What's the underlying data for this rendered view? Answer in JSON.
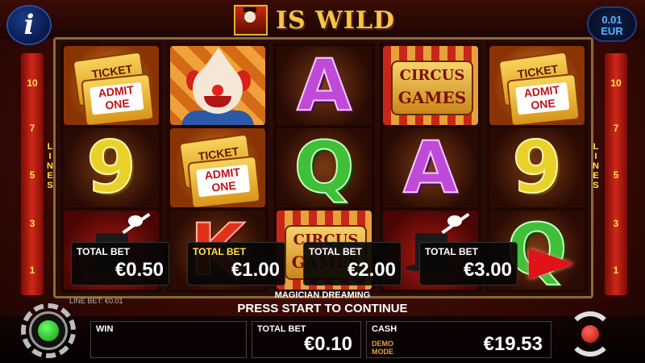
{
  "header": {
    "info_icon": "info-icon",
    "wild_text": "IS WILD",
    "coin_value": "0.01",
    "currency": "EUR"
  },
  "reels": [
    [
      {
        "symbol": "ticket",
        "line1": "TICKET",
        "line2": "ADMIT",
        "line3": "ONE"
      },
      {
        "symbol": "9",
        "color": "yellow"
      },
      {
        "symbol": "magician"
      }
    ],
    [
      {
        "symbol": "clown"
      },
      {
        "symbol": "ticket",
        "line1": "TICKET",
        "line2": "ADMIT",
        "line3": "ONE"
      },
      {
        "symbol": "K",
        "color": "red"
      }
    ],
    [
      {
        "symbol": "A",
        "color": "purple"
      },
      {
        "symbol": "Q",
        "color": "green"
      },
      {
        "symbol": "circus",
        "line1": "CIRCUS",
        "line2": "GAMES"
      }
    ],
    [
      {
        "symbol": "circus",
        "line1": "CIRCUS",
        "line2": "GAMES"
      },
      {
        "symbol": "A",
        "color": "purple"
      },
      {
        "symbol": "magician"
      }
    ],
    [
      {
        "symbol": "ticket",
        "line1": "TICKET",
        "line2": "ADMIT",
        "line3": "ONE"
      },
      {
        "symbol": "9",
        "color": "yellow"
      },
      {
        "symbol": "Q",
        "color": "green"
      }
    ]
  ],
  "lines": {
    "label": "LINES",
    "left": [
      "10",
      "7",
      "5",
      "3",
      "1"
    ],
    "right": [
      "10",
      "7",
      "5",
      "3",
      "1"
    ]
  },
  "bets": [
    {
      "label": "TOTAL BET",
      "value": "€0.50"
    },
    {
      "label": "TOTAL BET",
      "value": "€1.00"
    },
    {
      "label": "TOTAL BET",
      "value": "€2.00"
    },
    {
      "label": "TOTAL BET",
      "value": "€3.00"
    }
  ],
  "status": {
    "symbol_name": "MAGICIAN DREAMING",
    "message": "PRESS START TO CONTINUE",
    "line_bet": "LINE BET: €0.01"
  },
  "bottom": {
    "win_label": "WIN",
    "win_value": "",
    "total_bet_label": "TOTAL BET",
    "total_bet_value": "€0.10",
    "cash_label": "CASH",
    "demo_mode": "DEMO MODE",
    "cash_value": "€19.53"
  },
  "colors": {
    "accent_yellow": "#ffe44a",
    "play_red": "#e0121a",
    "start_green": "#1ccf1c"
  }
}
